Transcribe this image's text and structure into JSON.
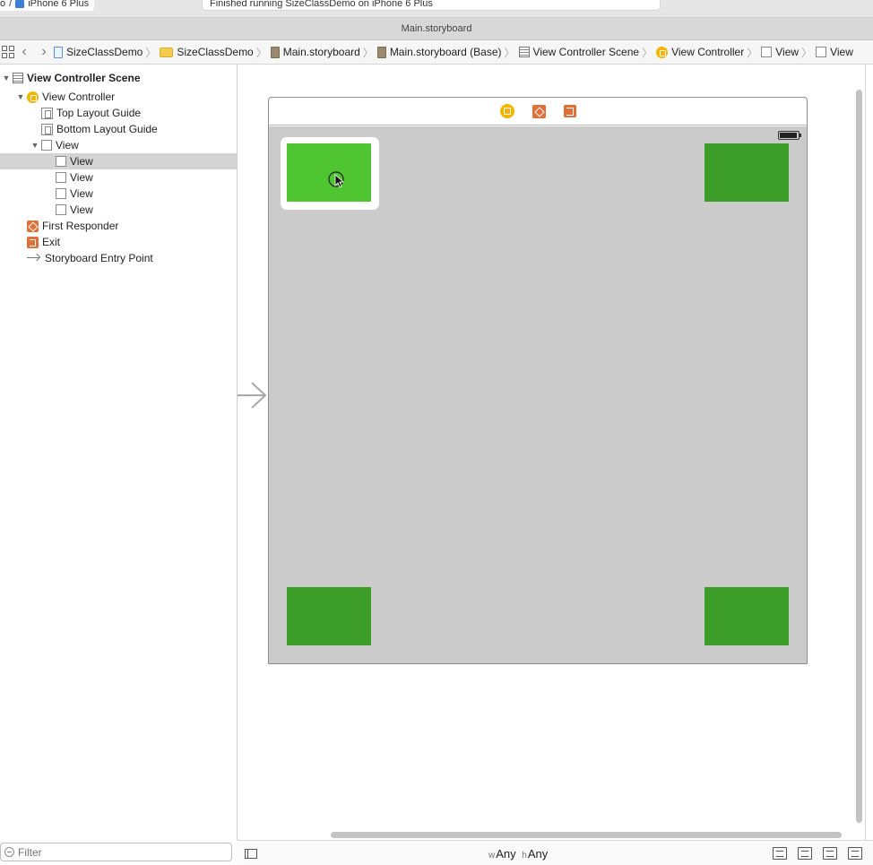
{
  "toolbar": {
    "scheme_prefix": "o",
    "scheme_sep": "/",
    "device": "iPhone 6 Plus",
    "status": "Finished running SizeClassDemo on iPhone 6 Plus"
  },
  "window": {
    "title": "Main.storyboard"
  },
  "jumpbar": {
    "crumbs": [
      {
        "label": "SizeClassDemo",
        "icon": "project-file-icon"
      },
      {
        "label": "SizeClassDemo",
        "icon": "folder-icon"
      },
      {
        "label": "Main.storyboard",
        "icon": "storyboard-icon"
      },
      {
        "label": "Main.storyboard (Base)",
        "icon": "storyboard-icon"
      },
      {
        "label": "View Controller Scene",
        "icon": "scene-icon"
      },
      {
        "label": "View Controller",
        "icon": "view-controller-icon"
      },
      {
        "label": "View",
        "icon": "view-icon"
      },
      {
        "label": "View",
        "icon": "view-icon"
      }
    ]
  },
  "outline": {
    "items": [
      {
        "label": "View Controller Scene"
      },
      {
        "label": "View Controller"
      },
      {
        "label": "Top Layout Guide"
      },
      {
        "label": "Bottom Layout Guide"
      },
      {
        "label": "View"
      },
      {
        "label": "View"
      },
      {
        "label": "View"
      },
      {
        "label": "View"
      },
      {
        "label": "View"
      },
      {
        "label": "First Responder"
      },
      {
        "label": "Exit"
      },
      {
        "label": "Storyboard Entry Point"
      }
    ],
    "selected_index": 5
  },
  "filter": {
    "placeholder": "Filter"
  },
  "bottombar": {
    "w_key": "w",
    "w_value": "Any",
    "h_key": "h",
    "h_value": "Any"
  },
  "colors": {
    "selected_view": "#4ec531",
    "view_fill": "#3c9e28",
    "root_view": "#cbcbcb"
  }
}
